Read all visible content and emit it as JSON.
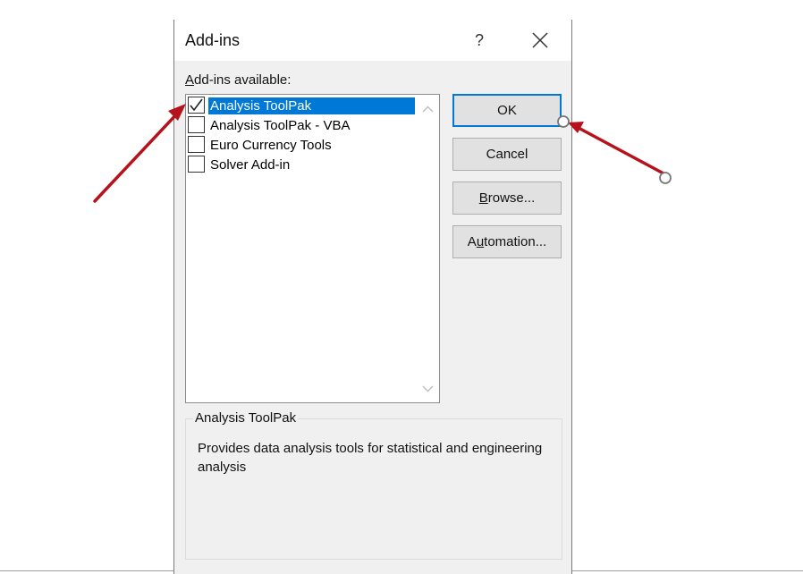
{
  "dialog": {
    "title": "Add-ins",
    "help_label": "?",
    "available_label_prefix": "A",
    "available_label_rest": "dd-ins available:",
    "addins": [
      {
        "label": "Analysis ToolPak",
        "checked": true,
        "selected": true
      },
      {
        "label": "Analysis ToolPak - VBA",
        "checked": false,
        "selected": false
      },
      {
        "label": "Euro Currency Tools",
        "checked": false,
        "selected": false
      },
      {
        "label": "Solver Add-in",
        "checked": false,
        "selected": false
      }
    ],
    "buttons": {
      "ok": "OK",
      "cancel": "Cancel",
      "browse_prefix": "B",
      "browse_rest": "rowse...",
      "automation_prefix": "A",
      "automation_mid": "u",
      "automation_rest": "tomation..."
    },
    "description": {
      "title": "Analysis ToolPak",
      "text": "Provides data analysis tools for statistical and engineering analysis"
    }
  },
  "colors": {
    "selection": "#0078d7",
    "annotation_arrow": "#b5121b"
  }
}
